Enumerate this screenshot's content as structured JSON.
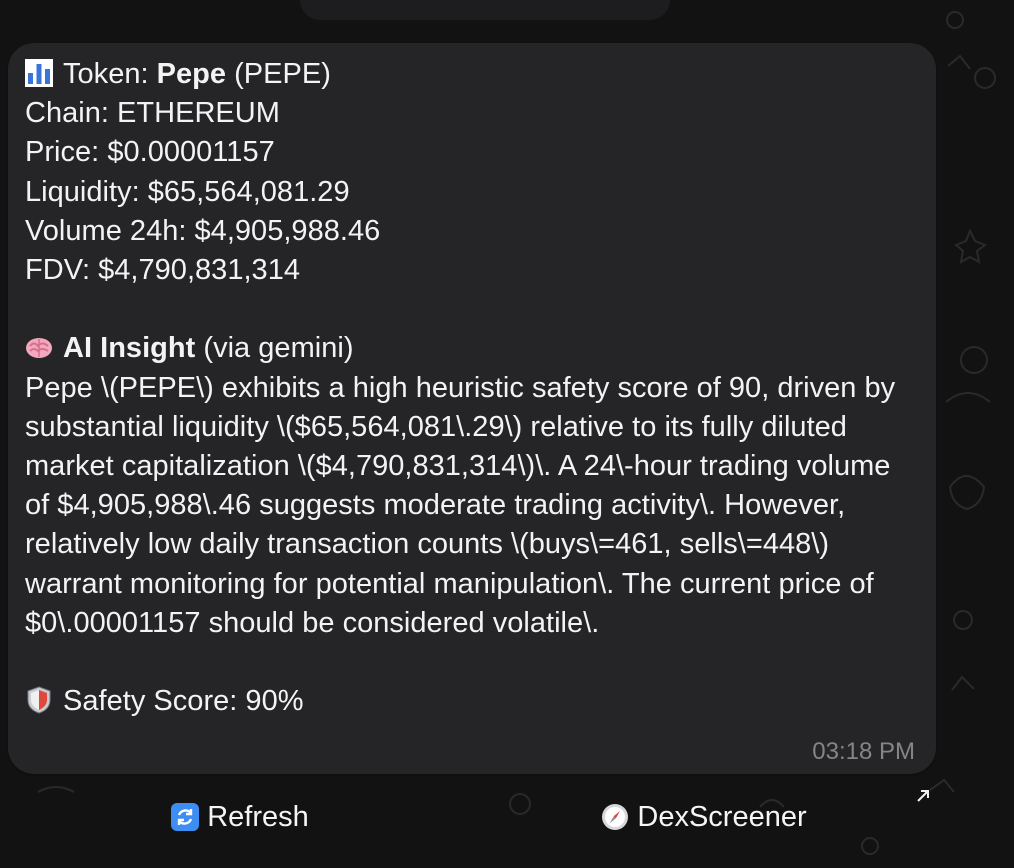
{
  "message": {
    "token_label": "Token: ",
    "token_name": "Pepe",
    "token_symbol": " (PEPE)",
    "chain": "Chain: ETHEREUM",
    "price": "Price: $0.00001157",
    "liquidity": "Liquidity: $65,564,081.29",
    "volume": "Volume 24h: $4,905,988.46",
    "fdv": "FDV: $4,790,831,314",
    "insight_title": "AI Insight",
    "insight_source": " (via gemini)",
    "insight_text": "Pepe \\(PEPE\\) exhibits a high heuristic safety score of 90, driven by substantial liquidity \\($65,564,081\\.29\\) relative to its fully diluted market capitalization \\($4,790,831,314\\)\\.  A 24\\-hour trading volume of $4,905,988\\.46 suggests moderate trading activity\\.  However, relatively low daily transaction counts \\(buys\\=461, sells\\=448\\) warrant monitoring for potential manipulation\\. The current price of $0\\.00001157 should be considered volatile\\.",
    "safety_label": "Safety Score",
    "safety_value": ": 90%",
    "timestamp": "03:18 PM"
  },
  "buttons": {
    "refresh": "Refresh",
    "dexscreener": "DexScreener"
  },
  "icons": {
    "chart": "bar-chart-icon",
    "brain": "brain-icon",
    "shield": "shield-icon",
    "refresh": "refresh-icon",
    "compass": "compass-icon",
    "external": "external-link-icon"
  },
  "colors": {
    "background": "#121212",
    "bubble": "#252527",
    "text": "#f3f3f3",
    "timestamp": "#858585"
  }
}
